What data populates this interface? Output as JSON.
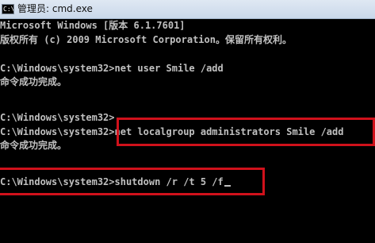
{
  "titlebar": {
    "icon_glyph": "C:\\",
    "title": "管理员: cmd.exe"
  },
  "console": {
    "lines": [
      "Microsoft Windows [版本 6.1.7601]",
      "版权所有 (c) 2009 Microsoft Corporation。保留所有权利。",
      "",
      "C:\\Windows\\system32>net user Smile /add",
      "命令成功完成。",
      "",
      "",
      "C:\\Windows\\system32>",
      "C:\\Windows\\system32>net localgroup administrators Smile /add",
      "命令成功完成。",
      "",
      "",
      "C:\\Windows\\system32>shutdown /r /t 5 /f"
    ]
  },
  "colors": {
    "console_text": "#c0c0c0",
    "highlight": "#d0111b"
  }
}
